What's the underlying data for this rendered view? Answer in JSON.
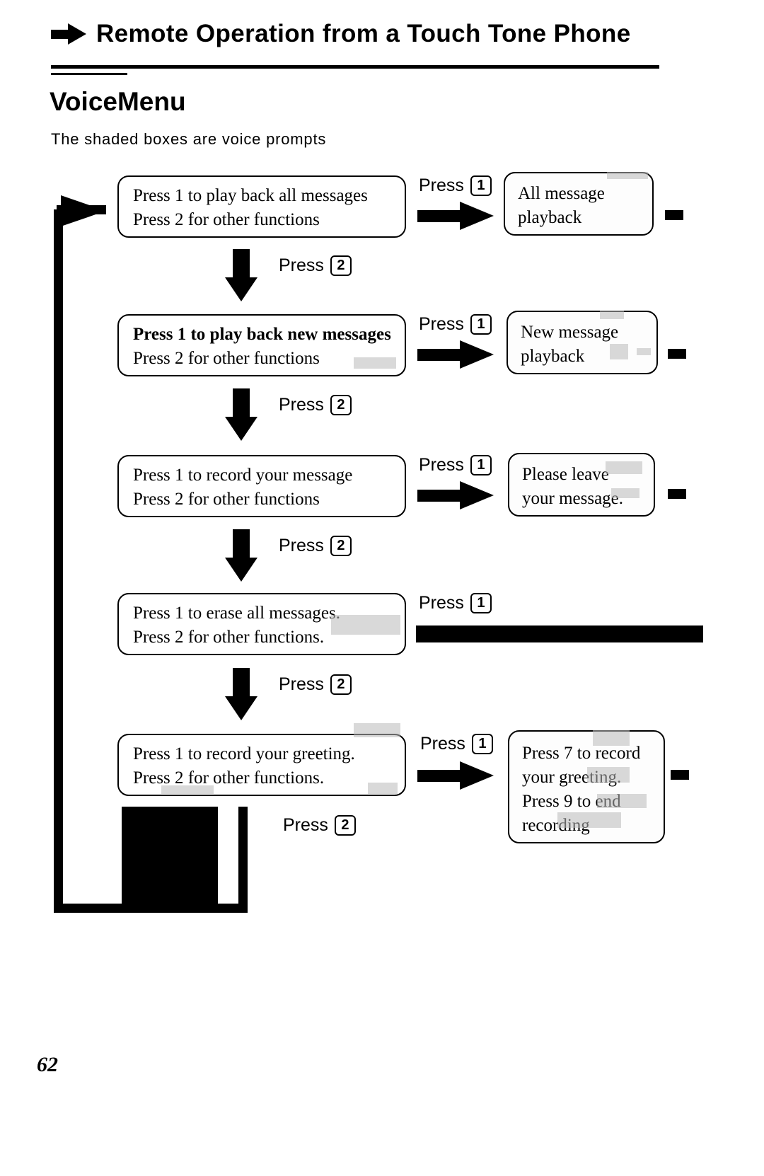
{
  "header": {
    "arrow_icon": "right-arrow-icon",
    "title": "Remote Operation from a Touch Tone Phone"
  },
  "section": {
    "title": "VoiceMenu",
    "subtitle": "The shaded boxes are voice prompts"
  },
  "page_number": "62",
  "flow": {
    "press_word": "Press",
    "key_one": "1",
    "key_two": "2",
    "steps": [
      {
        "id": "step-all-messages",
        "menu": {
          "line1": "Press 1 to play back all messages",
          "line2": "Press 2 for other functions"
        },
        "branch_key": "1",
        "voice": {
          "line1": "All message",
          "line2": "playback",
          "line3": "",
          "line4": ""
        },
        "next_key": "2"
      },
      {
        "id": "step-new-messages",
        "menu": {
          "line1": "Press 1 to play back new messages",
          "line2": "Press 2 for other functions"
        },
        "branch_key": "1",
        "voice": {
          "line1": "New message",
          "line2": "playback",
          "line3": "",
          "line4": ""
        },
        "next_key": "2"
      },
      {
        "id": "step-record-message",
        "menu": {
          "line1": "Press 1 to record your message",
          "line2": "Press 2 for other functions"
        },
        "branch_key": "1",
        "voice": {
          "line1": "Please leave",
          "line2": "your message.",
          "line3": "",
          "line4": ""
        },
        "next_key": "2"
      },
      {
        "id": "step-erase-messages",
        "menu": {
          "line1": "Press 1 to erase all messages.",
          "line2": "Press 2 for other functions."
        },
        "branch_key": "1",
        "voice": {
          "line1": "",
          "line2": "",
          "line3": "",
          "line4": ""
        },
        "next_key": "2"
      },
      {
        "id": "step-record-greeting",
        "menu": {
          "line1": "Press 1 to record your greeting.",
          "line2": "Press 2 for other functions."
        },
        "branch_key": "1",
        "voice": {
          "line1": "Press 7 to record",
          "line2": "your greeting.",
          "line3": "Press 9 to end",
          "line4": "recording"
        },
        "next_key": "2"
      }
    ]
  },
  "colors": {
    "ink": "#000000",
    "paper": "#ffffff",
    "smudge": "#b9b9b9"
  }
}
